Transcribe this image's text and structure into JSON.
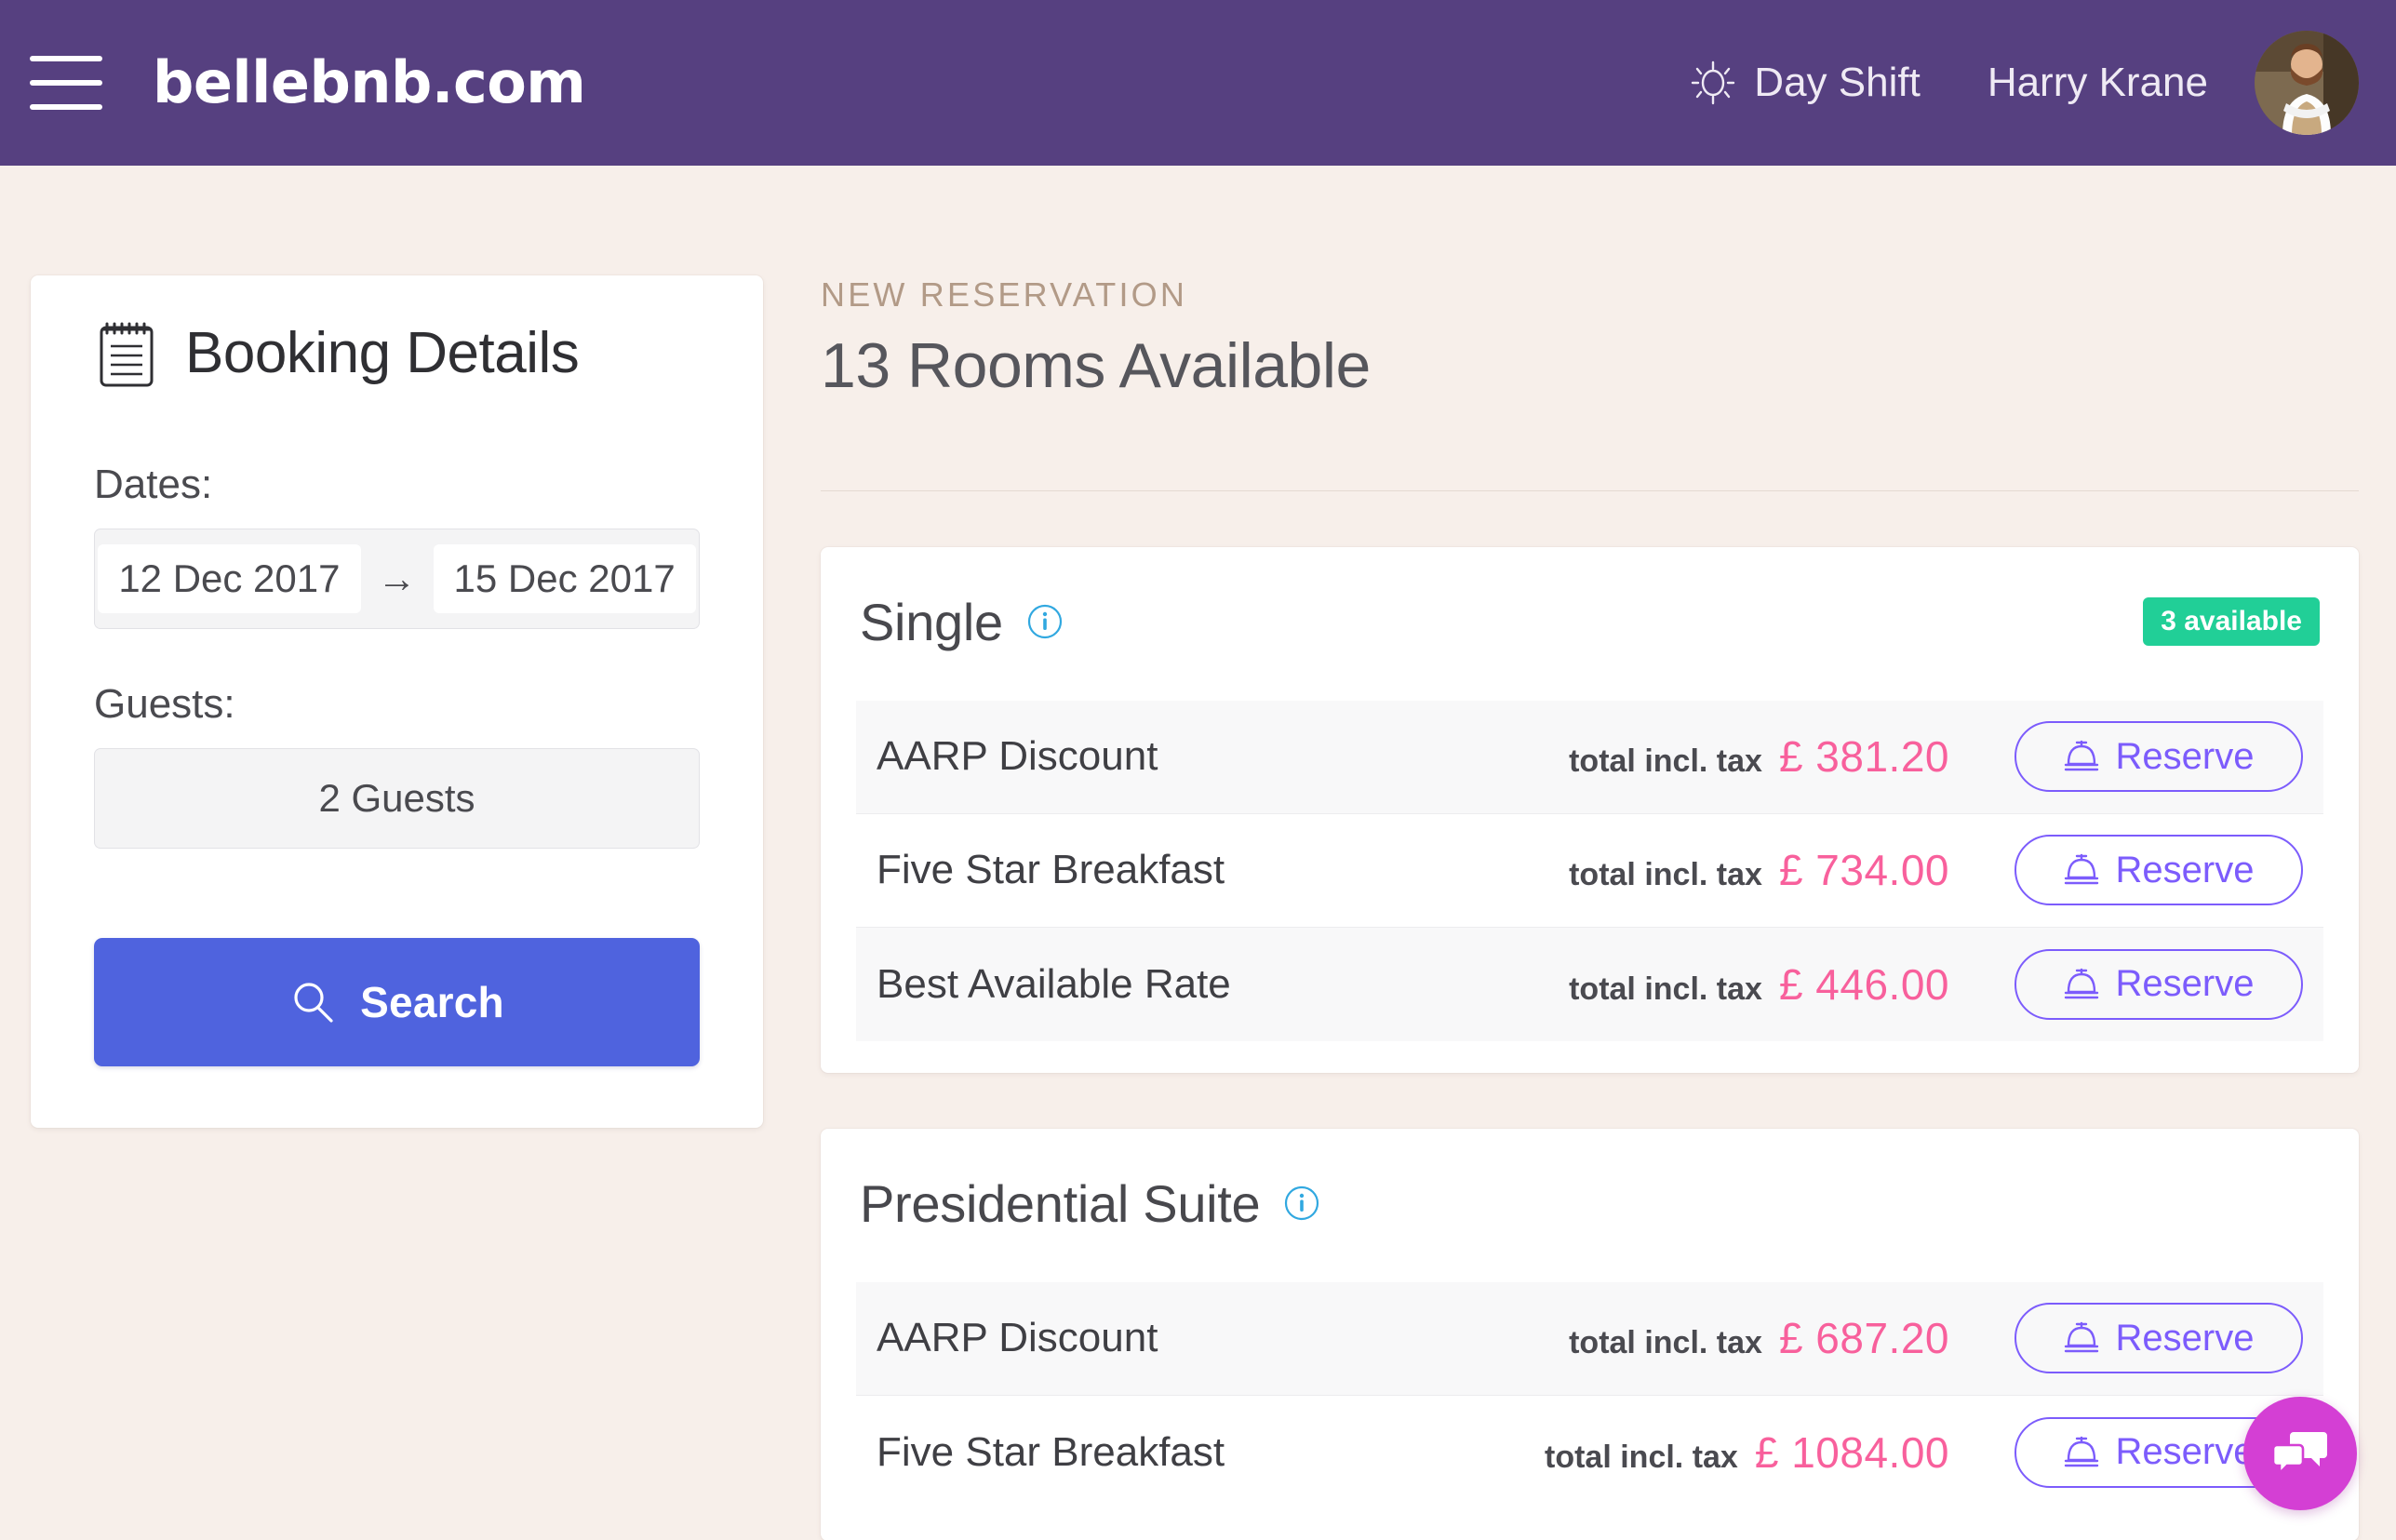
{
  "topbar": {
    "menu_icon": "hamburger-icon",
    "brand": "bellebnb.com",
    "shift_icon": "sun-icon",
    "shift_label": "Day Shift",
    "user_name": "Harry Krane",
    "avatar_icon": "user-avatar",
    "bg_color": "#564080"
  },
  "booking": {
    "icon": "notepad-icon",
    "title": "Booking Details",
    "dates_label": "Dates:",
    "date_from": "12 Dec 2017",
    "date_arrow": "→",
    "date_to": "15 Dec 2017",
    "guests_label": "Guests:",
    "guests_value": "2 Guests",
    "search_icon": "search-icon",
    "search_label": "Search",
    "search_color": "#4f63de"
  },
  "main": {
    "eyebrow": "NEW RESERVATION",
    "title": "13 Rooms Available",
    "eyebrow_color": "#b29a87"
  },
  "rooms": [
    {
      "name": "Single",
      "info_icon": "info-circle-icon",
      "badge": "3 available",
      "badge_color": "#21cf97",
      "rates": [
        {
          "name": "AARP Discount",
          "tax_label": "total incl. tax",
          "price": "£ 381.20",
          "reserve_icon": "bell-icon",
          "reserve_label": "Reserve"
        },
        {
          "name": "Five Star Breakfast",
          "tax_label": "total incl. tax",
          "price": "£ 734.00",
          "reserve_icon": "bell-icon",
          "reserve_label": "Reserve"
        },
        {
          "name": "Best Available Rate",
          "tax_label": "total incl. tax",
          "price": "£ 446.00",
          "reserve_icon": "bell-icon",
          "reserve_label": "Reserve"
        }
      ]
    },
    {
      "name": "Presidential Suite",
      "info_icon": "info-circle-icon",
      "badge": "",
      "badge_color": "#21cf97",
      "rates": [
        {
          "name": "AARP Discount",
          "tax_label": "total incl. tax",
          "price": "£ 687.20",
          "reserve_icon": "bell-icon",
          "reserve_label": "Reserve"
        },
        {
          "name": "Five Star Breakfast",
          "tax_label": "total incl. tax",
          "price": "£ 1084.00",
          "reserve_icon": "bell-icon",
          "reserve_label": "Reserve"
        }
      ]
    }
  ],
  "chat": {
    "icon": "chat-bubbles-icon",
    "color": "#d43fd4"
  }
}
